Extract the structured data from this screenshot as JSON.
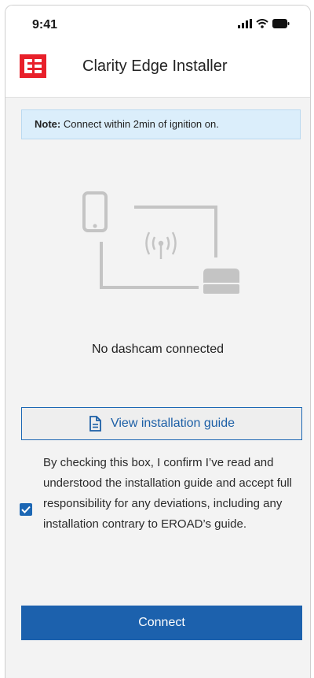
{
  "status_bar": {
    "time": "9:41",
    "icons": [
      "cellular-signal-icon",
      "wifi-icon",
      "battery-icon"
    ]
  },
  "header": {
    "logo": "eroad-logo",
    "title": "Clarity Edge Installer"
  },
  "note": {
    "label": "Note:",
    "text": "Connect within 2min of ignition on."
  },
  "illustration": {
    "icons": [
      "phone-icon",
      "antenna-icon",
      "dashcam-device-icon"
    ]
  },
  "connection_status": "No dashcam connected",
  "guide_button": {
    "label": "View installation guide",
    "icon": "document-icon"
  },
  "consent": {
    "checked": true,
    "text": "By checking this box, I confirm I’ve read and understood the installation guide and accept full responsibility for any deviations, including any installation contrary to EROAD’s guide."
  },
  "connect_button": {
    "label": "Connect"
  },
  "colors": {
    "brand_red": "#e8202a",
    "primary_blue": "#1c61ad",
    "note_bg": "#dbeefb",
    "screen_bg": "#f3f3f3"
  }
}
